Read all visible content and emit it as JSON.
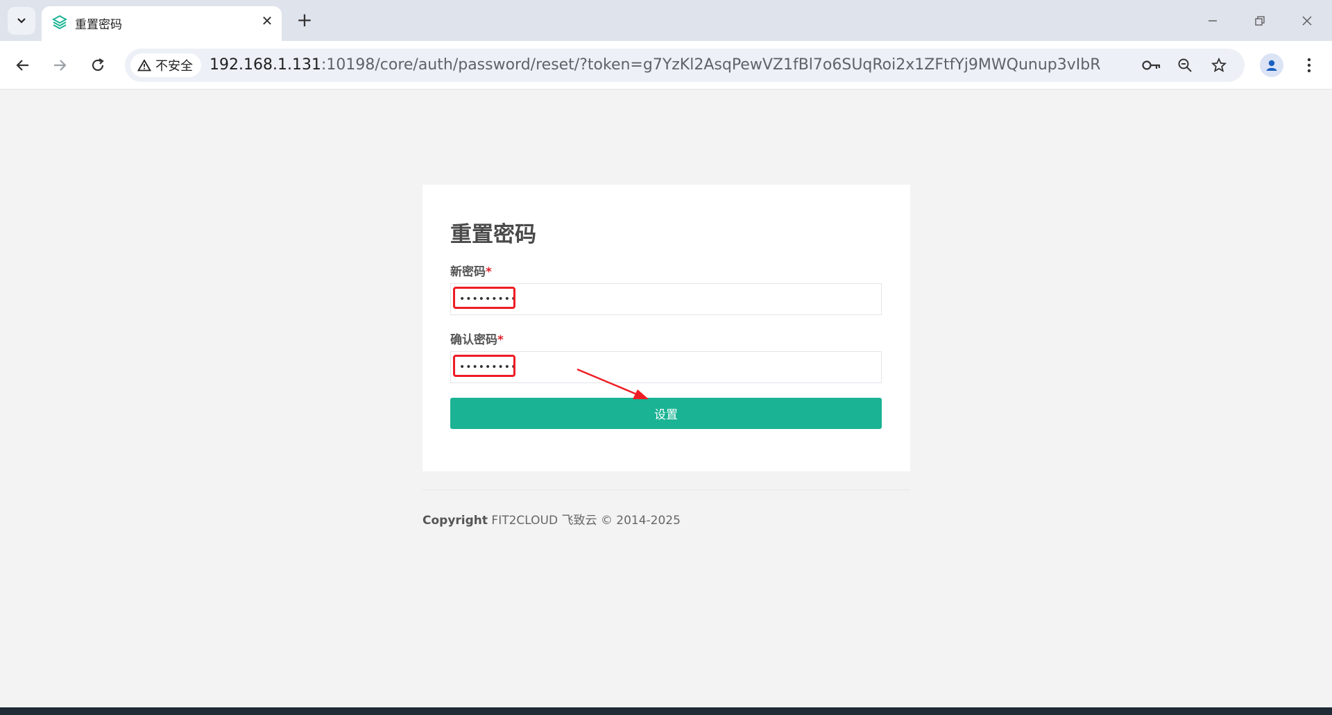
{
  "browser": {
    "tab": {
      "title": "重置密码"
    },
    "address": {
      "security_label": "不安全",
      "url_host": "192.168.1.131",
      "url_rest": ":10198/core/auth/password/reset/?token=g7YzKl2AsqPewVZ1fBl7o6SUqRoi2x1ZFtfYj9MWQunup3vIbR"
    },
    "icons": {
      "tab_search": "chevron-down-icon",
      "favicon": "layers-favicon-icon",
      "back": "back-arrow-icon",
      "forward": "forward-arrow-icon",
      "reload": "reload-icon",
      "password_key": "key-icon",
      "zoom": "zoom-icon",
      "bookmark": "star-icon",
      "profile": "profile-icon",
      "menu": "kebab-menu-icon"
    }
  },
  "page": {
    "title": "重置密码",
    "new_password": {
      "label": "新密码",
      "required_mark": "*",
      "value": "•••••••••"
    },
    "confirm_password": {
      "label": "确认密码",
      "required_mark": "*",
      "value": "•••••••••"
    },
    "submit_label": "设置",
    "footer": {
      "copyright_label": "Copyright",
      "copyright_text": " FIT2CLOUD 飞致云 © 2014-2025"
    }
  },
  "colors": {
    "accent": "#1ab394",
    "annotation": "#ee1c24",
    "page_background": "#f3f3f4"
  }
}
